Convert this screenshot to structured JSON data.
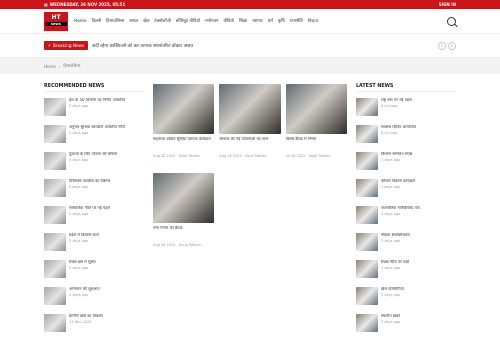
{
  "topbar": {
    "date": "WEDNESDAY, 26 NOV 2025, 05:51",
    "signin": "SIGN IN"
  },
  "header": {
    "logo_main": "HT",
    "logo_sub": "NEWS",
    "nav_items": [
      "Home",
      "दिल्ली",
      "हिमाचलिन्स",
      "बंगाल",
      "खेल",
      "टेक्नोलॉजी",
      "बॉलिवुड वीडियो",
      "मनोरंजन",
      "वीडियो",
      "शिक्षा",
      "व्यापार",
      "धर्म",
      "कृषि",
      "राजनीति",
      "More"
    ]
  },
  "breaking": {
    "label": "Breaking News",
    "text": "सर्दी रहेगा कार्डियाओ को कर व्यापक स्थानांतरित डॉक्टर अजय"
  },
  "breadcrumb": {
    "home": "Home",
    "current": "हिमाचलिन्स"
  },
  "recommended": {
    "title": "RECOMMENDED NEWS",
    "items": [
      {
        "title": "देश के 50 विभागों का निर्णय आधारित",
        "date": "5 days ago"
      },
      {
        "title": "अनुभव सुविधा कार्यक्रम आधारित नीति",
        "date": "5 days ago"
      },
      {
        "title": "युवाओं के लिए योजना की घोषणा",
        "date": "5 days ago"
      },
      {
        "title": "चिकित्सा व्यवस्था का विस्तार",
        "date": "5 days ago"
      },
      {
        "title": "सामाजिक नीति पर नई पहल",
        "date": "5 days ago"
      },
      {
        "title": "प्रदेश में विकास कार्य",
        "date": "5 days ago"
      },
      {
        "title": "शिक्षा क्षेत्र में सुधार",
        "date": "5 days ago"
      },
      {
        "title": "अभियान की शुरुआत",
        "date": "5 days ago"
      },
      {
        "title": "ग्रामीण क्षेत्रों का विकास",
        "date": "13 Nov 2025"
      }
    ]
  },
  "featured": {
    "cards": [
      {
        "title": "महाराजा डॉक्टर सुविधा व्यापक कार्यक्रम",
        "date": "Aug 28 2025",
        "author": "Sejal Pathan"
      },
      {
        "title": "सरकार की नई योजनाओं का लाभ",
        "date": "Aug 26 2025",
        "author": "Sejal Pathan"
      },
      {
        "title": "विशेष बैठक में निर्णय",
        "date": "Jul 26 2025",
        "author": "Sejal Pathan"
      },
      {
        "title": "नगर निगम की बैठक",
        "date": "Aug 26 2025",
        "author": "Anup Pathan"
      }
    ]
  },
  "latest": {
    "title": "LATEST NEWS",
    "items": [
      {
        "title": "राष्ट्र स्तर पर नई पहल",
        "date": "6 hrs ago"
      },
      {
        "title": "स्वास्थ्य शिविर आयोजित",
        "date": "8 hrs ago"
      },
      {
        "title": "किसान सम्मेलन संपन्न",
        "date": "1 days ago"
      },
      {
        "title": "कौशल विकास कार्यक्रम",
        "date": "2 days ago"
      },
      {
        "title": "राजनीतिक गतिविधियां तेज",
        "date": "3 days ago"
      },
      {
        "title": "महिला सशक्तिकरण",
        "date": "3 days ago"
      },
      {
        "title": "शिक्षा नीति पर चर्चा",
        "date": "3 days ago"
      },
      {
        "title": "खेल प्रतियोगिता",
        "date": "3 days ago"
      },
      {
        "title": "स्थानीय खबरें",
        "date": "3 days ago"
      }
    ]
  }
}
